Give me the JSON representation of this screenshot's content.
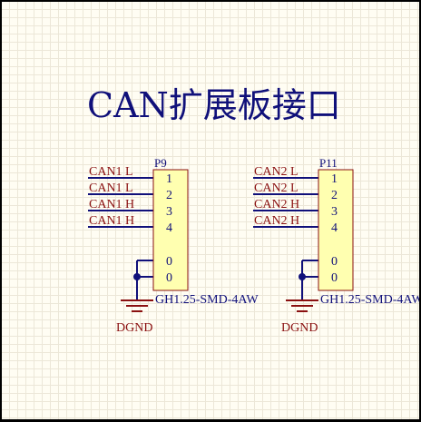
{
  "title": "CAN扩展板接口",
  "colors": {
    "title": "#10107a",
    "wire": "#10107a",
    "net_label": "#8a1010",
    "component_fill": "#ffffb0",
    "component_border": "#8a1010",
    "ground": "#8a1010",
    "junction": "#10107a"
  },
  "connectors": [
    {
      "designator": "P9",
      "comment": "GH1.25-SMD-4AW",
      "pins": [
        "1",
        "2",
        "3",
        "4",
        "0",
        "0"
      ],
      "nets": [
        "CAN1 L",
        "CAN1 L",
        "CAN1 H",
        "CAN1 H"
      ],
      "ground_label": "DGND"
    },
    {
      "designator": "P11",
      "comment": "GH1.25-SMD-4AW",
      "pins": [
        "1",
        "2",
        "3",
        "4",
        "0",
        "0"
      ],
      "nets": [
        "CAN2 L",
        "CAN2 L",
        "CAN2 H",
        "CAN2 H"
      ],
      "ground_label": "DGND"
    }
  ]
}
